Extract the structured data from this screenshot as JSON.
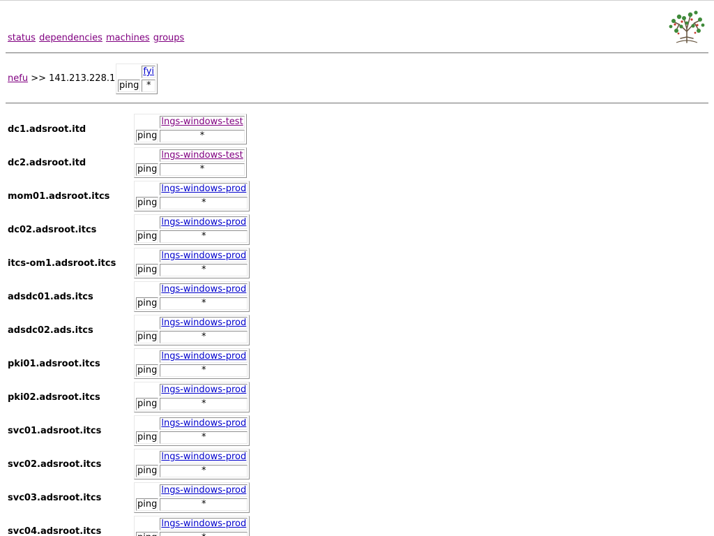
{
  "nav": [
    {
      "label": "status"
    },
    {
      "label": "dependencies"
    },
    {
      "label": "machines"
    },
    {
      "label": "groups"
    }
  ],
  "breadcrumb": {
    "root_link": "nefu",
    "separator": ">>",
    "ip": "141.213.228.1"
  },
  "summary": {
    "group_link": "fyi",
    "service": "ping",
    "status": "*"
  },
  "hosts": [
    {
      "name": "dc1.adsroot.itd",
      "group": "lngs-windows-test",
      "service": "ping",
      "status": "*",
      "visited": true
    },
    {
      "name": "dc2.adsroot.itd",
      "group": "lngs-windows-test",
      "service": "ping",
      "status": "*",
      "visited": true
    },
    {
      "name": "mom01.adsroot.itcs",
      "group": "lngs-windows-prod",
      "service": "ping",
      "status": "*",
      "visited": false
    },
    {
      "name": "dc02.adsroot.itcs",
      "group": "lngs-windows-prod",
      "service": "ping",
      "status": "*",
      "visited": false
    },
    {
      "name": "itcs-om1.adsroot.itcs",
      "group": "lngs-windows-prod",
      "service": "ping",
      "status": "*",
      "visited": false
    },
    {
      "name": "adsdc01.ads.itcs",
      "group": "lngs-windows-prod",
      "service": "ping",
      "status": "*",
      "visited": false
    },
    {
      "name": "adsdc02.ads.itcs",
      "group": "lngs-windows-prod",
      "service": "ping",
      "status": "*",
      "visited": false
    },
    {
      "name": "pki01.adsroot.itcs",
      "group": "lngs-windows-prod",
      "service": "ping",
      "status": "*",
      "visited": false
    },
    {
      "name": "pki02.adsroot.itcs",
      "group": "lngs-windows-prod",
      "service": "ping",
      "status": "*",
      "visited": false
    },
    {
      "name": "svc01.adsroot.itcs",
      "group": "lngs-windows-prod",
      "service": "ping",
      "status": "*",
      "visited": false
    },
    {
      "name": "svc02.adsroot.itcs",
      "group": "lngs-windows-prod",
      "service": "ping",
      "status": "*",
      "visited": false
    },
    {
      "name": "svc03.adsroot.itcs",
      "group": "lngs-windows-prod",
      "service": "ping",
      "status": "*",
      "visited": false
    },
    {
      "name": "svc04.adsroot.itcs",
      "group": "lngs-windows-prod",
      "service": "ping",
      "status": "*",
      "visited": false
    }
  ],
  "logo_icon": "tree-icon",
  "colors": {
    "visited_link": "#800080",
    "link": "#0000cc",
    "rule": "#8a8a8a"
  }
}
